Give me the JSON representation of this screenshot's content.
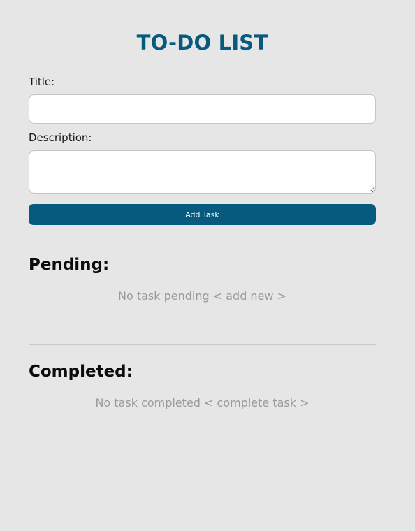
{
  "app": {
    "title": "TO-DO LIST"
  },
  "form": {
    "title_label": "Title:",
    "title_value": "",
    "description_label": "Description:",
    "description_value": "",
    "add_button_label": "Add Task"
  },
  "pending": {
    "heading": "Pending:",
    "empty_message": "No task pending < add new >"
  },
  "completed": {
    "heading": "Completed:",
    "empty_message": "No task completed < complete task >"
  },
  "colors": {
    "page_background": "#e6e6e6",
    "accent": "#065a7e",
    "muted_text": "#9a9a9a",
    "divider": "#c9c9c9"
  }
}
